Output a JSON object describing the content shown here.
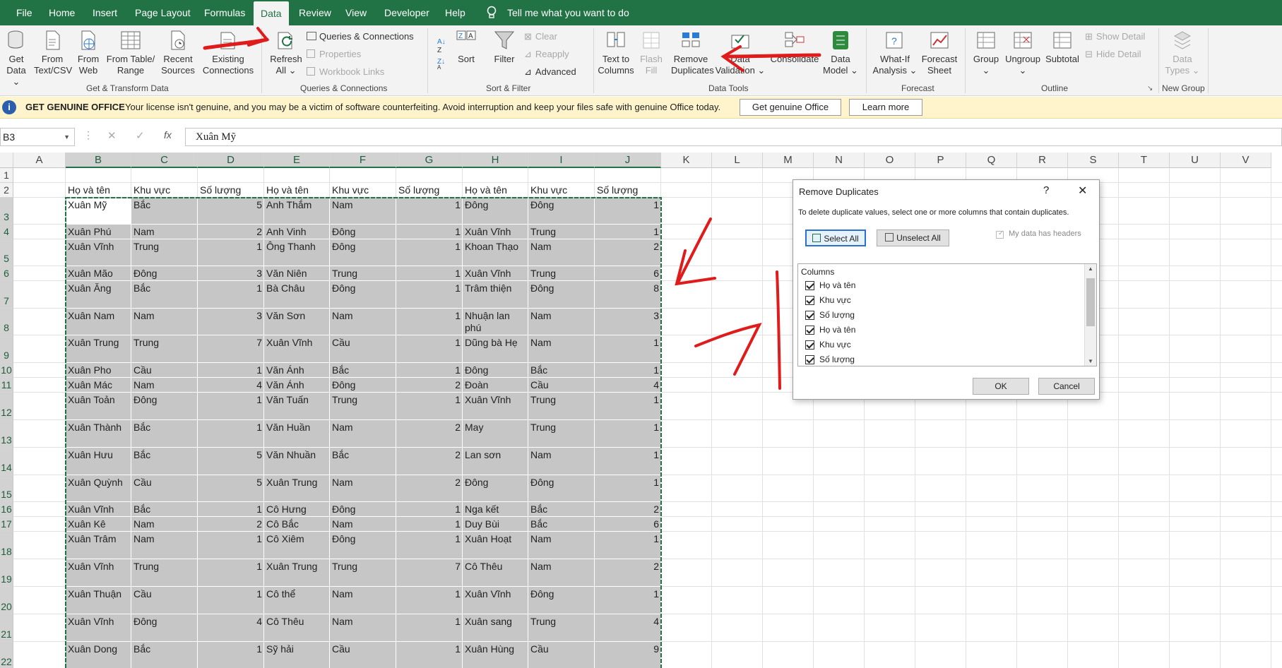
{
  "tabs": [
    "File",
    "Home",
    "Insert",
    "Page Layout",
    "Formulas",
    "Data",
    "Review",
    "View",
    "Developer",
    "Help"
  ],
  "tell_me": "Tell me what you want to do",
  "ribbon": {
    "get_data": "Get\nData ⌄",
    "from_text_csv": "From\nText/CSV",
    "from_web": "From\nWeb",
    "from_table_range": "From Table/\nRange",
    "recent_sources": "Recent\nSources",
    "existing_connections": "Existing\nConnections",
    "group_get_transform": "Get & Transform Data",
    "refresh_all": "Refresh\nAll ⌄",
    "queries_connections": "Queries & Connections",
    "properties": "Properties",
    "workbook_links": "Workbook Links",
    "group_queries": "Queries & Connections",
    "sort": "Sort",
    "filter": "Filter",
    "clear": "Clear",
    "reapply": "Reapply",
    "advanced": "Advanced",
    "group_sort_filter": "Sort & Filter",
    "text_to_columns": "Text to\nColumns",
    "flash_fill": "Flash\nFill",
    "remove_duplicates": "Remove\nDuplicates",
    "data_validation": "Data\nValidation ⌄",
    "consolidate": "Consolidate",
    "data_model": "Data\nModel ⌄",
    "group_data_tools": "Data Tools",
    "what_if": "What-If\nAnalysis ⌄",
    "forecast_sheet": "Forecast\nSheet",
    "group_forecast": "Forecast",
    "group_btn": "Group\n⌄",
    "ungroup": "Ungroup\n⌄",
    "subtotal": "Subtotal",
    "show_detail": "Show Detail",
    "hide_detail": "Hide Detail",
    "group_outline": "Outline",
    "data_types": "Data\nTypes ⌄",
    "group_new": "New Group"
  },
  "message_bar": {
    "title": "GET GENUINE OFFICE",
    "text": "Your license isn't genuine, and you may be a victim of software counterfeiting. Avoid interruption and keep your files safe with genuine Office today.",
    "btn_get": "Get genuine Office",
    "btn_learn": "Learn more"
  },
  "formula_bar": {
    "name_box": "B3",
    "fx": "fx",
    "value": "Xuân Mỹ"
  },
  "columns": [
    "A",
    "B",
    "C",
    "D",
    "E",
    "F",
    "G",
    "H",
    "I",
    "J",
    "K",
    "L",
    "M",
    "N",
    "O",
    "P",
    "Q",
    "R",
    "S",
    "T",
    "U",
    "V"
  ],
  "headers": [
    "Họ và tên",
    "Khu vực",
    "Số lượng",
    "Họ và tên",
    "Khu vực",
    "Số lượng",
    "Họ và tên",
    "Khu vực",
    "Số lượng"
  ],
  "rows": [
    {
      "n": "3",
      "c": [
        "Xuân Mỹ",
        "Bắc",
        "5",
        "Anh Thắm",
        "Nam",
        "1",
        "Đông",
        "Đông",
        "1"
      ]
    },
    {
      "n": "4",
      "c": [
        "Xuân Phú",
        "Nam",
        "2",
        "Anh Vinh",
        "Đông",
        "1",
        "Xuân Vĩnh",
        "Trung",
        "1"
      ]
    },
    {
      "n": "5",
      "c": [
        "Xuân Vĩnh",
        "Trung",
        "1",
        "Ông Thanh",
        "Đông",
        "1",
        "Khoan Thạo",
        "Nam",
        "2"
      ]
    },
    {
      "n": "6",
      "c": [
        "Xuân Mão",
        "Đông",
        "3",
        "Văn Niên",
        "Trung",
        "1",
        "Xuân Vĩnh",
        "Trung",
        "6"
      ]
    },
    {
      "n": "7",
      "c": [
        "Xuân Ăng",
        "Bắc",
        "1",
        "Bà Châu",
        "Đông",
        "1",
        "Trâm thiện",
        "Đông",
        "8"
      ]
    },
    {
      "n": "8",
      "c": [
        "Xuân Nam",
        "Nam",
        "3",
        "Văn Sơn",
        "Nam",
        "1",
        "Nhuận lan phú",
        "Nam",
        "3"
      ]
    },
    {
      "n": "9",
      "c": [
        "Xuân Trung",
        "Trung",
        "7",
        "Xuân Vĩnh",
        "Cầu",
        "1",
        "Dũng bà Hẹ",
        "Nam",
        "1"
      ]
    },
    {
      "n": "10",
      "c": [
        "Xuân Pho",
        "Cầu",
        "1",
        "Văn Ánh",
        "Bắc",
        "1",
        "Đông",
        "Bắc",
        "1"
      ]
    },
    {
      "n": "11",
      "c": [
        "Xuân Mác",
        "Nam",
        "4",
        "Văn Ánh",
        "Đông",
        "2",
        "Đoàn",
        "Cầu",
        "4"
      ]
    },
    {
      "n": "12",
      "c": [
        "Xuân Toản",
        "Đông",
        "1",
        "Văn Tuấn",
        "Trung",
        "1",
        "Xuân Vĩnh",
        "Trung",
        "1"
      ]
    },
    {
      "n": "13",
      "c": [
        "Xuân Thành",
        "Bắc",
        "1",
        "Văn Huần",
        "Nam",
        "2",
        "May",
        "Trung",
        "1"
      ]
    },
    {
      "n": "14",
      "c": [
        "Xuân Hưu",
        "Bắc",
        "5",
        "Văn Nhuần",
        "Bắc",
        "2",
        "Lan sơn",
        "Nam",
        "1"
      ]
    },
    {
      "n": "15",
      "c": [
        "Xuân Quỳnh",
        "Cầu",
        "5",
        "Xuân Trung",
        "Nam",
        "2",
        "Đông",
        "Đông",
        "1"
      ]
    },
    {
      "n": "16",
      "c": [
        "Xuân Vĩnh",
        "Bắc",
        "1",
        "Cô Hưng",
        "Đông",
        "1",
        "Nga kết",
        "Bắc",
        "2"
      ]
    },
    {
      "n": "17",
      "c": [
        "Xuân Kê",
        "Nam",
        "2",
        "Cô Bắc",
        "Nam",
        "1",
        "Duy Bùi",
        "Bắc",
        "6"
      ]
    },
    {
      "n": "18",
      "c": [
        "Xuân Trâm",
        "Nam",
        "1",
        "Cô Xiêm",
        "Đông",
        "1",
        "Xuân Hoạt",
        "Nam",
        "1"
      ]
    },
    {
      "n": "19",
      "c": [
        "Xuân Vĩnh",
        "Trung",
        "1",
        "Xuân Trung",
        "Trung",
        "7",
        "Cô Thêu",
        "Nam",
        "2"
      ]
    },
    {
      "n": "20",
      "c": [
        "Xuân Thuận",
        "Cầu",
        "1",
        "Cô thể",
        "Nam",
        "1",
        "Xuân Vĩnh",
        "Đông",
        "1"
      ]
    },
    {
      "n": "21",
      "c": [
        "Xuân Vĩnh",
        "Đông",
        "4",
        "Cô Thêu",
        "Nam",
        "1",
        "Xuân sang",
        "Trung",
        "4"
      ]
    },
    {
      "n": "22",
      "c": [
        "Xuân Dong",
        "Bắc",
        "1",
        "Sỹ hải",
        "Cầu",
        "1",
        "Xuân Hùng",
        "Cầu",
        "9"
      ]
    }
  ],
  "dialog": {
    "title": "Remove Duplicates",
    "help": "?",
    "close": "✕",
    "instruction": "To delete duplicate values, select one or more columns that contain duplicates.",
    "select_all": "Select All",
    "unselect_all": "Unselect All",
    "headers_option": "My data has headers",
    "columns_label": "Columns",
    "column_items": [
      "Họ và tên",
      "Khu vực",
      "Số lượng",
      "Họ và tên",
      "Khu vực",
      "Số lượng"
    ],
    "ok": "OK",
    "cancel": "Cancel"
  },
  "colors": {
    "accent": "#217346",
    "selection": "#c6c6c6",
    "annotation": "#e01b1b"
  }
}
